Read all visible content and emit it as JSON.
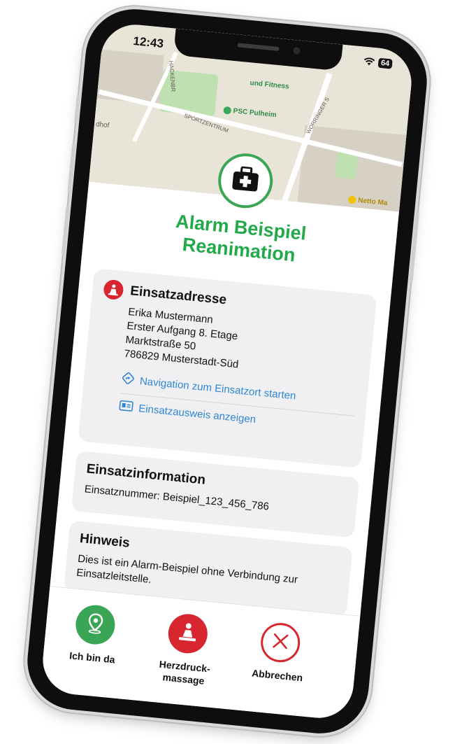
{
  "status_bar": {
    "time": "12:43",
    "battery": "64"
  },
  "map": {
    "labels": {
      "fitness": "und Fitness",
      "psc": "PSC Pulheim",
      "sportzentrum": "SPORTZENTRUM",
      "friedhof": "dhof",
      "worringer": "WORRINGER S",
      "hackenbr": "HACKENBR",
      "netto": "Netto Ma"
    }
  },
  "title": {
    "line1": "Alarm Beispiel",
    "line2": "Reanimation"
  },
  "address": {
    "heading": "Einsatzadresse",
    "lines": [
      "Erika Mustermann",
      "Erster Aufgang 8. Etage",
      "Marktstraße 50",
      "786829 Musterstadt-Süd"
    ],
    "navigation_link": "Navigation zum Einsatzort starten",
    "id_link": "Einsatzausweis anzeigen"
  },
  "info": {
    "heading": "Einsatzinformation",
    "number_label": "Einsatznummer:",
    "number_value": "Beispiel_123_456_786"
  },
  "hint": {
    "heading": "Hinweis",
    "text": "Dies ist ein Alarm-Beispiel ohne Verbindung zur Einsatzleitstelle."
  },
  "actions": {
    "arrived": "Ich bin da",
    "cpr_line1": "Herzdruck-",
    "cpr_line2": "massage",
    "cancel": "Abbrechen"
  },
  "colors": {
    "green": "#22a94a",
    "red": "#d7262f",
    "link": "#2f86d4"
  }
}
